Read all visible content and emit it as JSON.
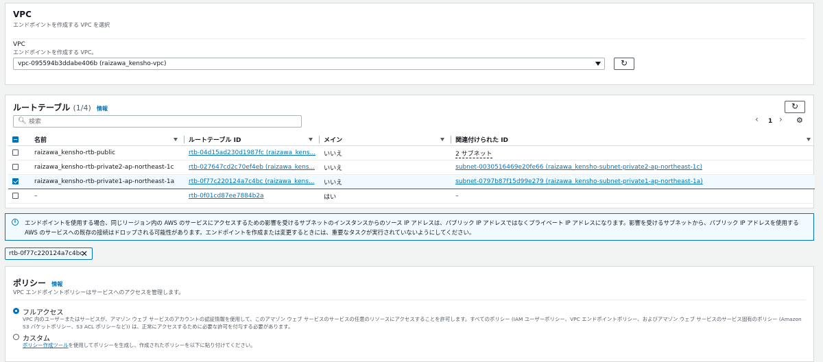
{
  "vpc": {
    "title": "VPC",
    "subtitle": "エンドポイントを作成する VPC を選択",
    "field_label": "VPC",
    "field_desc": "エンドポイントを作成する VPC。",
    "selected_value": "vpc-095594b3ddabe406b (raizawa_kensho-vpc)"
  },
  "route_tables": {
    "title": "ルートテーブル",
    "count": "(1/4)",
    "info": "情報",
    "search_placeholder": "検索",
    "page": "1",
    "columns": [
      "名前",
      "ルートテーブル ID",
      "メイン",
      "関連付けられた ID"
    ],
    "rows": [
      {
        "name": "raizawa_kensho-rtb-public",
        "id": "rtb-04d15ad230d1987fc (raizawa_kens...",
        "main": "いいえ",
        "assoc": "2 サブネット",
        "selected": false
      },
      {
        "name": "raizawa_kensho-rtb-private2-ap-northeast-1c",
        "id": "rtb-027647cd2c70ef4eb (raizawa_kens...",
        "main": "いいえ",
        "assoc": "subnet-0030516469e20fe66 (raizawa_kensho-subnet-private2-ap-northeast-1c)",
        "selected": false
      },
      {
        "name": "raizawa_kensho-rtb-private1-ap-northeast-1a",
        "id": "rtb-0f77c220124a7c4bc (raizawa_kens...",
        "main": "いいえ",
        "assoc": "subnet-0797b87f15d99e279 (raizawa_kensho-subnet-private1-ap-northeast-1a)",
        "selected": true
      },
      {
        "name": "–",
        "id": "rtb-0f01cd87ee7884b2a",
        "main": "はい",
        "assoc": "–",
        "selected": false
      }
    ]
  },
  "alert": {
    "text": "エンドポイントを使用する場合、同じリージョン内の AWS のサービスにアクセスするための影響を受けるサブネットのインスタンスからのソース IP アドレスは、パブリック IP アドレスではなくプライベート IP アドレスになります。影響を受けるサブネットから、パブリック IP アドレスを使用する AWS のサービスへの既存の接続はドロップされる可能性があります。エンドポイントを作成または変更するときには、重要なタスクが実行されていないようにしてください。"
  },
  "token": {
    "label": "rtb-0f77c220124a7c4bc"
  },
  "policy": {
    "title": "ポリシー",
    "info": "情報",
    "subtitle": "VPC エンドポイントポリシーはサービスへのアクセスを管理します。",
    "full_access_label": "フルアクセス",
    "full_access_desc": "VPC 内のユーザーまたはサービスが、アマゾン ウェブ サービスのアカウントの認証情報を使用して、このアマゾン ウェブ サービスのサービスの任意のリソースにアクセスすることを許可します。すべてのポリシー (IAM ユーザーポリシー、VPC エンドポイントポリシー、およびアマゾン ウェブ サービスのサービス固有のポリシー (Amazon S3 バケットポリシー、S3 ACL ポリシーなど)) は、正常にアクセスするために必要な許可を付与する必要があります。",
    "custom_label": "カスタム",
    "custom_link": "ポリシー作成ツール",
    "custom_desc": "を使用してポリシーを生成し、作成されたポリシーを以下に貼り付けてください。"
  }
}
